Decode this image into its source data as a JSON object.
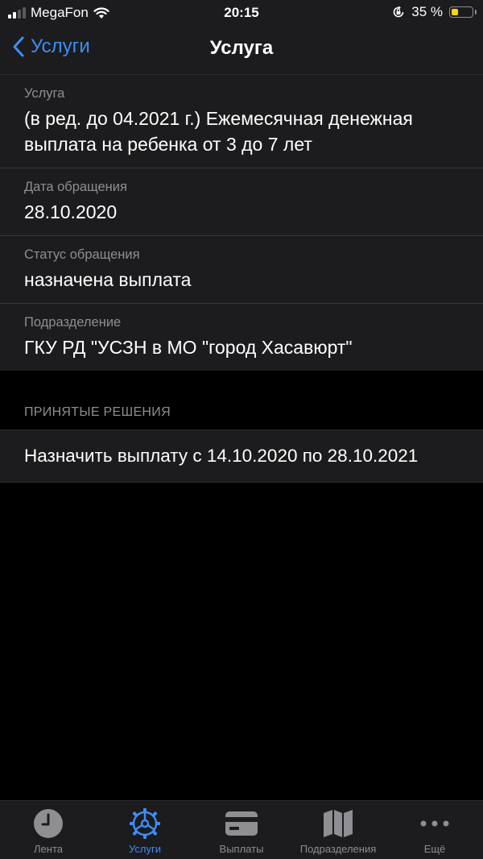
{
  "status_bar": {
    "carrier": "MegaFon",
    "time": "20:15",
    "battery": "35 %",
    "battery_level": 0.35
  },
  "nav": {
    "back_label": "Услуги",
    "title": "Услуга"
  },
  "details": [
    {
      "label": "Услуга",
      "value": "(в ред. до 04.2021 г.) Ежемесячная денежная выплата на ребенка от 3 до 7 лет"
    },
    {
      "label": "Дата обращения",
      "value": "28.10.2020"
    },
    {
      "label": "Статус обращения",
      "value": "назначена выплата"
    },
    {
      "label": "Подразделение",
      "value": "ГКУ РД \"УСЗН в МО \"город Хасавюрт\""
    }
  ],
  "decisions": {
    "header": "ПРИНЯТЫЕ РЕШЕНИЯ",
    "items": [
      "Назначить выплату с 14.10.2020 по 28.10.2021"
    ]
  },
  "tabs": [
    {
      "label": "Лента",
      "icon": "clock-icon"
    },
    {
      "label": "Услуги",
      "icon": "gear-icon"
    },
    {
      "label": "Выплаты",
      "icon": "card-icon"
    },
    {
      "label": "Подразделения",
      "icon": "map-icon"
    },
    {
      "label": "Ещё",
      "icon": "more-icon"
    }
  ],
  "colors": {
    "accent": "#3d8ef7",
    "background": "#000000",
    "card": "#1c1c1e",
    "secondary_text": "#8e8e93"
  }
}
